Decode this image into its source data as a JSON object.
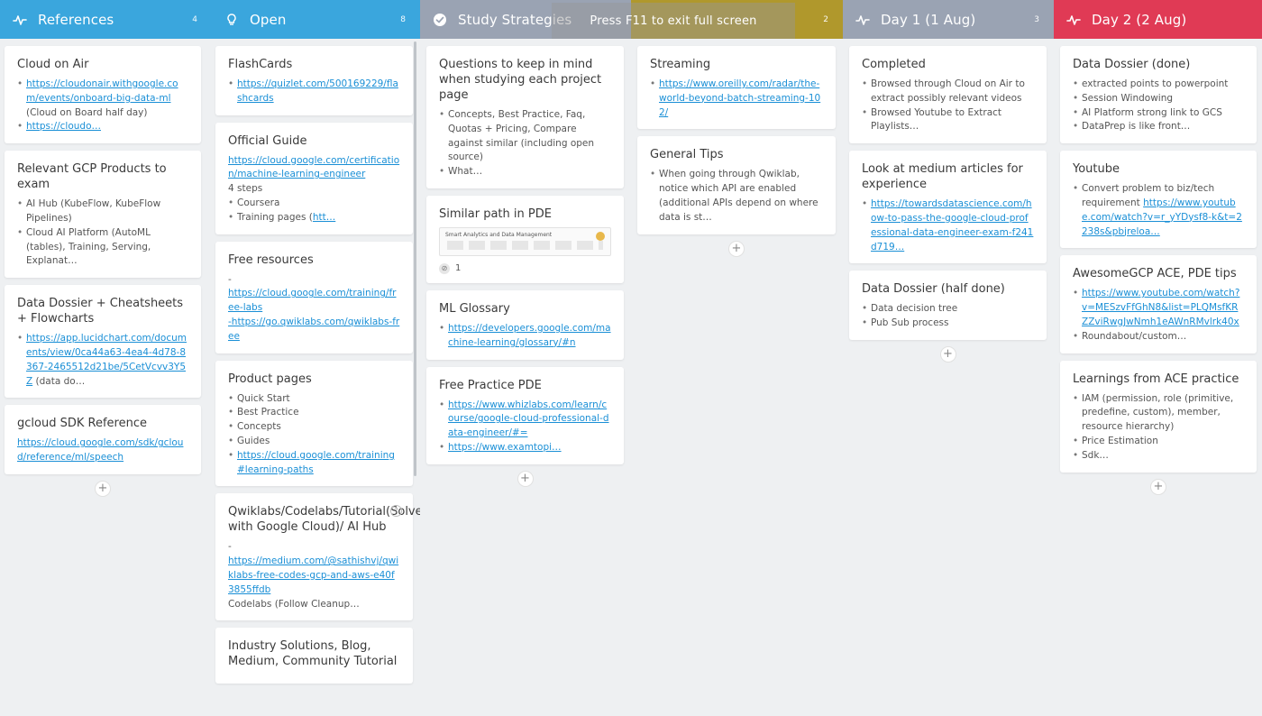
{
  "overlay": {
    "fullscreen_hint": "Press F11 to exit full screen"
  },
  "columns": [
    {
      "title": "References",
      "count": "4",
      "color": "#3aa6dd",
      "icon": "activity-icon",
      "cards": [
        {
          "title": "Cloud on Air",
          "bullets": [
            {
              "parts": [
                {
                  "t": "https://cloudonair.withgoogle.com/events/onboard-big-data-ml",
                  "link": true
                },
                {
                  "t": " (Cloud on Board half day)"
                }
              ]
            },
            {
              "parts": [
                {
                  "t": "https://cloudo…",
                  "link": true
                }
              ]
            }
          ]
        },
        {
          "title": "Relevant GCP Products to exam",
          "bullets": [
            {
              "parts": [
                {
                  "t": "AI Hub (KubeFlow, KubeFlow Pipelines)"
                }
              ]
            },
            {
              "parts": [
                {
                  "t": "Cloud AI Platform (AutoML (tables), Training, Serving, Explanat…"
                }
              ]
            }
          ]
        },
        {
          "title": "Data Dossier + Cheatsheets + Flowcharts",
          "bullets": [
            {
              "parts": [
                {
                  "t": "https://app.lucidchart.com/documents/view/0ca44a63-4ea4-4d78-8367-2465512d21be/5CetVcvv3Y5Z",
                  "link": true
                },
                {
                  "t": " (data do…"
                }
              ]
            }
          ]
        },
        {
          "title": "gcloud SDK Reference",
          "body": [
            {
              "t": "https://cloud.google.com/sdk/gcloud/reference/ml/speech",
              "link": true
            }
          ]
        }
      ]
    },
    {
      "title": "Open",
      "count": "8",
      "color": "#3aa6dd",
      "icon": "lightbulb-icon",
      "cards": [
        {
          "title": "FlashCards",
          "bullets": [
            {
              "parts": [
                {
                  "t": "https://quizlet.com/500169229/flashcards",
                  "link": true
                }
              ]
            }
          ]
        },
        {
          "title": "Official Guide",
          "body": [
            {
              "t": "https://cloud.google.com/certification/machine-learning-engineer",
              "link": true
            },
            {
              "t": " "
            },
            {
              "t": "4 steps"
            }
          ],
          "bullets": [
            {
              "parts": [
                {
                  "t": "Coursera"
                }
              ]
            },
            {
              "parts": [
                {
                  "t": "Training pages ("
                },
                {
                  "t": "htt…",
                  "link": true
                }
              ]
            }
          ]
        },
        {
          "title": "Free resources",
          "body": [
            {
              "t": "-"
            },
            {
              "t": "https://cloud.google.com/training/free-labs",
              "link": true
            },
            {
              "t": "-https://go.qwiklabs.com/qwiklabs-free",
              "link": true
            }
          ]
        },
        {
          "title": "Product pages",
          "bullets": [
            {
              "parts": [
                {
                  "t": "Quick Start"
                }
              ]
            },
            {
              "parts": [
                {
                  "t": "Best Practice"
                }
              ]
            },
            {
              "parts": [
                {
                  "t": "Concepts"
                }
              ]
            },
            {
              "parts": [
                {
                  "t": "Guides"
                }
              ]
            },
            {
              "parts": [
                {
                  "t": "https://cloud.google.com/training#learning-paths",
                  "link": true
                }
              ]
            }
          ]
        },
        {
          "title": "Qwiklabs/Codelabs/Tutorial(Solve with Google Cloud)/ AI Hub",
          "help": true,
          "body": [
            {
              "t": "-"
            },
            {
              "t": "https://medium.com/@sathishvj/qwiklabs-free-codes-gcp-and-aws-e40f3855ffdb",
              "link": true
            },
            {
              "t": " "
            },
            {
              "t": "Codelabs (Follow Cleanup…"
            }
          ]
        },
        {
          "title": "Industry Solutions, Blog, Medium, Community Tutorial",
          "body": []
        }
      ]
    },
    {
      "title": "Study Strategies",
      "count": "",
      "color": "#9aa3b3",
      "icon": "check-circle-icon",
      "cards": [
        {
          "title": "Questions to keep in mind when studying each project page",
          "bullets": [
            {
              "parts": [
                {
                  "t": "Concepts, Best Practice, Faq, Quotas + Pricing, Compare against similar (including open source)"
                }
              ]
            },
            {
              "parts": [
                {
                  "t": "What…"
                }
              ]
            }
          ]
        },
        {
          "title": "Similar path in PDE",
          "thumb": {
            "caption": "Smart Analytics and Data Management"
          },
          "attachments": "1"
        },
        {
          "title": "ML Glossary",
          "bullets": [
            {
              "parts": [
                {
                  "t": "https://developers.google.com/machine-learning/glossary/#n",
                  "link": true
                }
              ]
            }
          ]
        },
        {
          "title": "Free Practice PDE",
          "bullets": [
            {
              "parts": [
                {
                  "t": "https://www.whizlabs.com/learn/course/google-cloud-professional-data-engineer/#=",
                  "link": true
                }
              ]
            },
            {
              "parts": [
                {
                  "t": "https://www.examtopi…",
                  "link": true
                }
              ]
            }
          ]
        }
      ]
    },
    {
      "title": "",
      "count": "2",
      "color": "#b0982c",
      "icon": "",
      "cards": [
        {
          "title": "Streaming",
          "bullets": [
            {
              "parts": [
                {
                  "t": "https://www.oreilly.com/radar/the-world-beyond-batch-streaming-102/",
                  "link": true
                }
              ]
            }
          ]
        },
        {
          "title": "General Tips",
          "bullets": [
            {
              "parts": [
                {
                  "t": "When going through Qwiklab, notice which API are enabled (additional APIs depend on where data is st…"
                }
              ]
            }
          ]
        }
      ]
    },
    {
      "title": "Day 1 (1 Aug)",
      "count": "3",
      "color": "#9aa3b3",
      "icon": "activity-icon",
      "cards": [
        {
          "title": "Completed",
          "bullets": [
            {
              "parts": [
                {
                  "t": "Browsed through Cloud on Air to extract possibly relevant videos"
                }
              ]
            },
            {
              "parts": [
                {
                  "t": "Browsed Youtube to Extract Playlists…"
                }
              ]
            }
          ]
        },
        {
          "title": "Look at medium articles for experience",
          "bullets": [
            {
              "parts": [
                {
                  "t": "https://towardsdatascience.com/how-to-pass-the-google-cloud-professional-data-engineer-exam-f241d719…",
                  "link": true
                }
              ]
            }
          ]
        },
        {
          "title": "Data Dossier (half done)",
          "bullets": [
            {
              "parts": [
                {
                  "t": "Data decision tree"
                }
              ]
            },
            {
              "parts": [
                {
                  "t": "Pub Sub process"
                }
              ]
            }
          ]
        }
      ]
    },
    {
      "title": "Day 2 (2 Aug)",
      "count": "",
      "color": "#e03a55",
      "icon": "activity-icon",
      "cards": [
        {
          "title": "Data Dossier (done)",
          "bullets": [
            {
              "parts": [
                {
                  "t": "extracted points to powerpoint"
                }
              ]
            },
            {
              "parts": [
                {
                  "t": "Session Windowing"
                }
              ]
            },
            {
              "parts": [
                {
                  "t": "AI Platform strong link to GCS"
                }
              ]
            },
            {
              "parts": [
                {
                  "t": "DataPrep is like front…"
                }
              ]
            }
          ]
        },
        {
          "title": "Youtube",
          "bullets": [
            {
              "parts": [
                {
                  "t": "Convert problem to biz/tech requirement "
                },
                {
                  "t": "https://www.youtube.com/watch?v=r_yYDysf8-k&t=2238s&pbjreloa…",
                  "link": true
                }
              ]
            }
          ]
        },
        {
          "title": "AwesomeGCP ACE, PDE tips",
          "bullets": [
            {
              "parts": [
                {
                  "t": "https://www.youtube.com/watch?v=MESzvFfGhN8&list=PLQMsfKRZZviRwgJwNmh1eAWnRMvlrk40x",
                  "link": true
                }
              ]
            },
            {
              "parts": [
                {
                  "t": "Roundabout/custom…"
                }
              ]
            }
          ]
        },
        {
          "title": "Learnings from ACE practice",
          "bullets": [
            {
              "parts": [
                {
                  "t": "IAM (permission, role (primitive, predefine, custom), member, resource hierarchy)"
                }
              ]
            },
            {
              "parts": [
                {
                  "t": "Price Estimation"
                }
              ]
            },
            {
              "parts": [
                {
                  "t": "Sdk…"
                }
              ]
            }
          ]
        }
      ]
    }
  ]
}
